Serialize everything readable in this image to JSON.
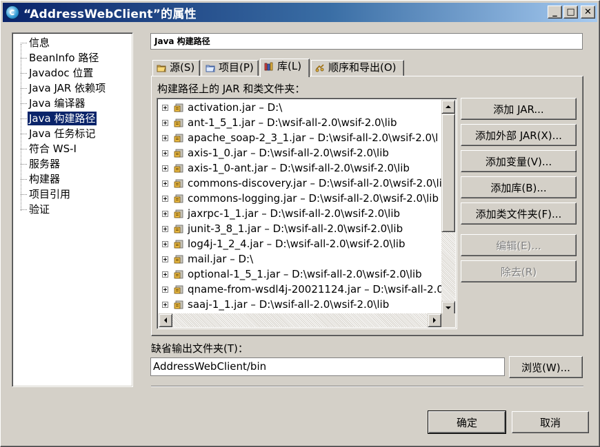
{
  "window": {
    "title": "“AddressWebClient”的属性",
    "minimize_glyph": "_",
    "maximize_glyph": "□",
    "close_glyph": "✕"
  },
  "nav": {
    "items": [
      {
        "label": "信息"
      },
      {
        "label": "BeanInfo 路径"
      },
      {
        "label": "Javadoc 位置"
      },
      {
        "label": "Java JAR 依赖项"
      },
      {
        "label": "Java 编译器"
      },
      {
        "label": "Java 构建路径",
        "selected": true
      },
      {
        "label": "Java 任务标记"
      },
      {
        "label": "符合 WS-I"
      },
      {
        "label": "服务器"
      },
      {
        "label": "构建器"
      },
      {
        "label": "项目引用"
      },
      {
        "label": "验证"
      }
    ]
  },
  "page": {
    "title": "Java 构建路径"
  },
  "tabs": [
    {
      "label": "源(S)",
      "icon": "source-folder-icon"
    },
    {
      "label": "项目(P)",
      "icon": "project-folder-icon"
    },
    {
      "label": "库(L)",
      "icon": "library-icon",
      "active": true
    },
    {
      "label": "顺序和导出(O)",
      "icon": "order-export-icon"
    }
  ],
  "libraries": {
    "label": "构建路径上的 JAR 和类文件夹：",
    "items": [
      "activation.jar – D:\\",
      "ant-1_5_1.jar – D:\\wsif-all-2.0\\wsif-2.0\\lib",
      "apache_soap-2_3_1.jar – D:\\wsif-all-2.0\\wsif-2.0\\l",
      "axis-1_0.jar – D:\\wsif-all-2.0\\wsif-2.0\\lib",
      "axis-1_0-ant.jar – D:\\wsif-all-2.0\\wsif-2.0\\lib",
      "commons-discovery.jar – D:\\wsif-all-2.0\\wsif-2.0\\li",
      "commons-logging.jar – D:\\wsif-all-2.0\\wsif-2.0\\lib",
      "jaxrpc-1_1.jar – D:\\wsif-all-2.0\\wsif-2.0\\lib",
      "junit-3_8_1.jar – D:\\wsif-all-2.0\\wsif-2.0\\lib",
      "log4j-1_2_4.jar – D:\\wsif-all-2.0\\wsif-2.0\\lib",
      "mail.jar – D:\\",
      "optional-1_5_1.jar – D:\\wsif-all-2.0\\wsif-2.0\\lib",
      "qname-from-wsdl4j-20021124.jar – D:\\wsif-all-2.0",
      "saaj-1_1.jar – D:\\wsif-all-2.0\\wsif-2.0\\lib"
    ]
  },
  "actions": {
    "add_jar": "添加 JAR...",
    "add_external_jar": "添加外部 JAR(X)...",
    "add_variable": "添加变量(V)...",
    "add_library": "添加库(B)...",
    "add_class_folder": "添加类文件夹(F)...",
    "edit": "编辑(E)...",
    "remove": "除去(R)"
  },
  "output": {
    "label": "缺省输出文件夹(T)：",
    "value": "AddressWebClient/bin",
    "browse": "浏览(W)..."
  },
  "dialog": {
    "ok": "确定",
    "cancel": "取消"
  }
}
